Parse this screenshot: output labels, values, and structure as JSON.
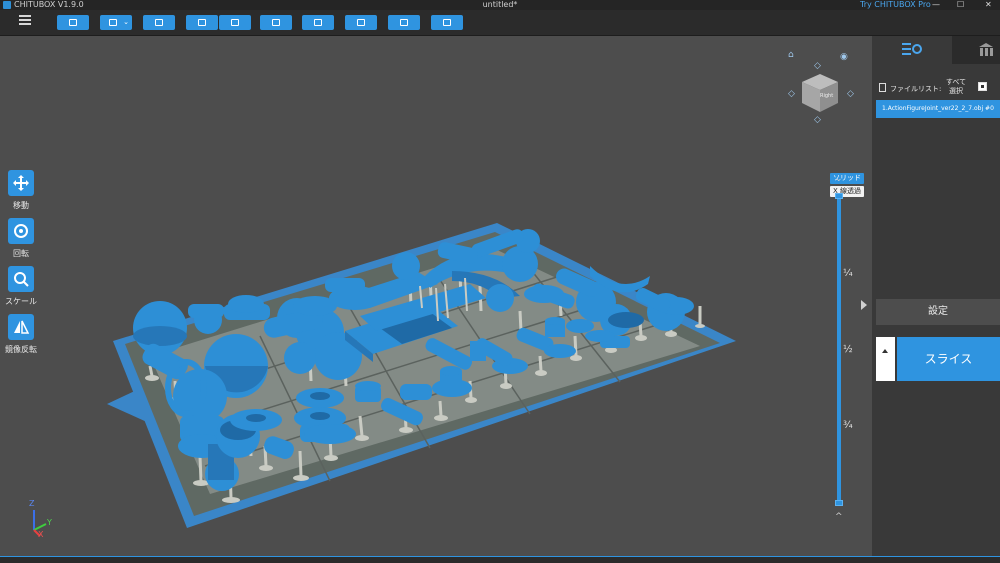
{
  "window": {
    "app_title": "CHITUBOX V1.9.0",
    "document_title": "untitled*",
    "pro_link": "Try CHITUBOX Pro",
    "minimize": "—",
    "maximize": "☐",
    "close": "✕"
  },
  "toolbar": {
    "buttons": [
      {
        "name": "open-file-icon"
      },
      {
        "name": "save-icon",
        "dropdown": "⌄"
      },
      {
        "name": "print-area-icon"
      },
      {
        "name": "import-icon"
      },
      {
        "name": "export-icon"
      },
      {
        "name": "sidebar-icon"
      },
      {
        "name": "arrange-icon"
      },
      {
        "name": "supports-icon"
      },
      {
        "name": "hollow-icon"
      },
      {
        "name": "lock-icon"
      }
    ]
  },
  "left_tools": [
    {
      "label": "移動",
      "icon": "move-icon"
    },
    {
      "label": "回転",
      "icon": "rotate-icon"
    },
    {
      "label": "スケール",
      "icon": "scale-icon"
    },
    {
      "label": "鏡像反転",
      "icon": "mirror-icon"
    }
  ],
  "view": {
    "solid_label": "ソリッド",
    "xray_label": "X 線透過",
    "cube_face": "Right",
    "home_icon": "⌂",
    "eye_icon": "◉",
    "arrow_up": "◇",
    "arrow_left": "◇",
    "arrow_right": "◇",
    "arrow_down": "◇"
  },
  "layer_slider": {
    "marks": [
      "¼",
      "½",
      "¾"
    ],
    "chev_up": "⌄",
    "chev_down": "^"
  },
  "axes": {
    "z": "Z",
    "y": "Y",
    "x": "X"
  },
  "panel": {
    "file_list_label": "ファイルリスト:",
    "select_all_label": "すべて選択",
    "file_item": "1.ActionFigureJoint_ver22_2_7.obj #0",
    "settings_label": "設定",
    "slice_label": "スライス"
  },
  "colors": {
    "accent": "#2f94e0",
    "model": "#2d8fd6",
    "support": "#c9cbc3",
    "plate": "#5f6963"
  }
}
